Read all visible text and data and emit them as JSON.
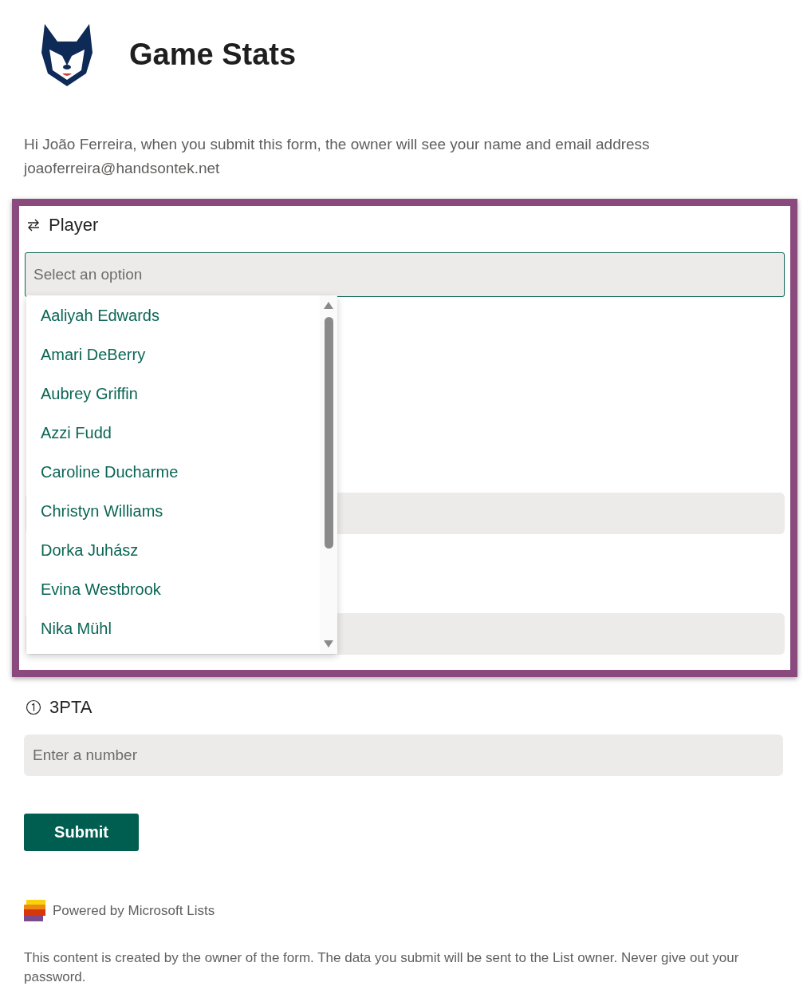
{
  "header": {
    "title": "Game Stats"
  },
  "intro": {
    "greeting": "Hi João Ferreira, when you submit this form, the owner will see your name and email address",
    "email": "joaoferreira@handsontek.net"
  },
  "player_field": {
    "label": "Player",
    "placeholder": "Select an option",
    "focused": true,
    "options": [
      {
        "label": "Aaliyah Edwards"
      },
      {
        "label": "Amari DeBerry"
      },
      {
        "label": "Aubrey Griffin"
      },
      {
        "label": "Azzi Fudd"
      },
      {
        "label": "Caroline Ducharme"
      },
      {
        "label": "Christyn Williams"
      },
      {
        "label": "Dorka Juhász"
      },
      {
        "label": "Evina Westbrook"
      },
      {
        "label": "Nika Mühl"
      }
    ]
  },
  "obscured_fields": [
    {
      "kind": "text-field"
    },
    {
      "kind": "text-field"
    }
  ],
  "fields": [
    {
      "label": "3PTA",
      "placeholder": "Enter a number"
    }
  ],
  "submit": {
    "label": "Submit"
  },
  "footer": {
    "powered_by": "Powered by Microsoft Lists",
    "disclaimer": "This content is created by the owner of the form. The data you submit will be sent to the List owner. Never give out your password."
  }
}
